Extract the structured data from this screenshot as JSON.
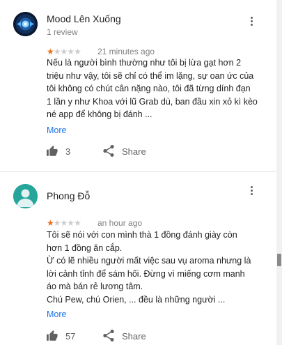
{
  "reviews": [
    {
      "author": "Mood Lên Xuống",
      "meta": "1 review",
      "rating": 1,
      "time": "21 minutes ago",
      "text_lines": [
        "Nếu là người bình thường như tôi bị lừa gạt hơn 2",
        "triệu như vậy, tôi sẽ chỉ có thể im lặng, sự oan ức của",
        "tôi không có chút cân nặng nào, tôi đã từng dính đạn",
        "1 lần y như Khoa với lũ Grab dù, ban đầu xin xỏ kì kèo",
        "né app để không bị đánh ..."
      ],
      "more": "More",
      "likes": "3",
      "share": "Share"
    },
    {
      "author": "Phong Đỗ",
      "rating": 1,
      "time": "an hour ago",
      "text_lines": [
        "Tôi sẽ nói với con mình thà 1 đồng đánh giày còn",
        "hơn 1 đồng ăn cắp.",
        "Ừ có lẽ nhiều người mất việc sau vụ aroma nhưng là",
        "lời cảnh tỉnh để sám hối. Đừng vì miếng cơm manh",
        "áo mà bán rẻ lương tâm.",
        "Chú Pew, chú Orien, ... đều là những người ..."
      ],
      "more": "More",
      "likes": "57",
      "share": "Share"
    }
  ],
  "colors": {
    "star_filled": "#e7711b",
    "star_empty": "#cccccc",
    "link": "#1a73e8",
    "avatar2": "#26a69a"
  },
  "icons": {
    "menu": "more-vert-icon",
    "like": "thumb-up-icon",
    "share": "share-icon",
    "avatar_default": "person-icon"
  }
}
